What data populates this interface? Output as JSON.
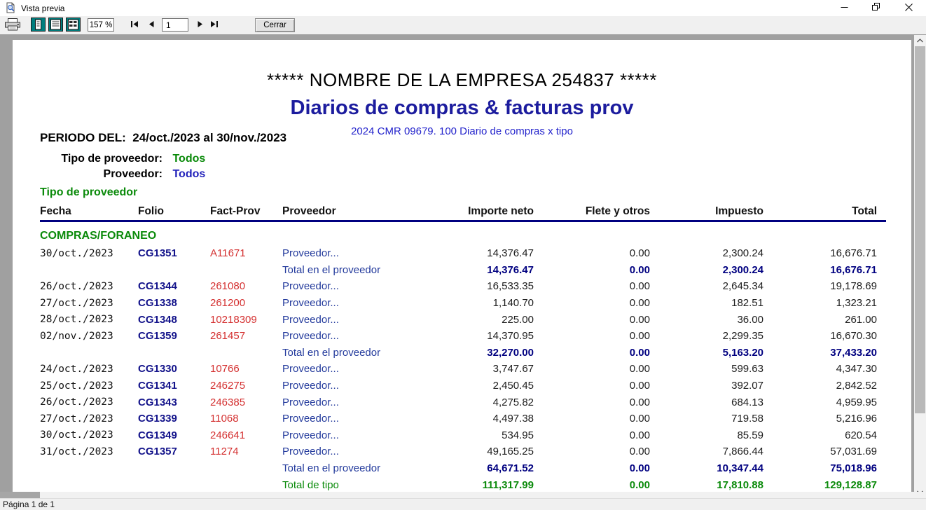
{
  "window": {
    "title": "Vista previa",
    "status": "Página 1 de 1"
  },
  "toolbar": {
    "zoom_value": "157 %",
    "page_value": "1",
    "close_label": "Cerrar"
  },
  "colors": {
    "navy": "#000080",
    "green": "#0a8a0a",
    "red": "#d43030",
    "blue": "#2424cc",
    "title_navy": "#1c1c9e",
    "view_icon_teal": "#007f7f"
  },
  "report": {
    "company_title": "***** NOMBRE DE LA EMPRESA 254837 *****",
    "title": "Diarios de compras & facturas prov",
    "subtitle": "2024 CMR 09679. 100 Diario de compras x tipo",
    "period_label": "PERIODO DEL:",
    "period_value": "24/oct./2023 al 30/nov./2023",
    "filter_type_label": "Tipo de proveedor:",
    "filter_type_value": "Todos",
    "filter_prov_label": "Proveedor:",
    "filter_prov_value": "Todos",
    "group_header": "Tipo de proveedor",
    "section": "COMPRAS/FORANEO",
    "columns": {
      "fecha": "Fecha",
      "folio": "Folio",
      "fact": "Fact-Prov",
      "prov": "Proveedor",
      "neto": "Importe neto",
      "flete": "Flete y otros",
      "imp": "Impuesto",
      "total": "Total"
    },
    "rows": [
      {
        "kind": "d",
        "fecha": "30/oct./2023",
        "folio": "CG1351",
        "fact": "A11671",
        "prov": "Proveedor...",
        "neto": "14,376.47",
        "flete": "0.00",
        "imp": "2,300.24",
        "total": "16,676.71"
      },
      {
        "kind": "s",
        "fecha": "",
        "folio": "",
        "fact": "",
        "prov": "Total en el proveedor",
        "neto": "14,376.47",
        "flete": "0.00",
        "imp": "2,300.24",
        "total": "16,676.71"
      },
      {
        "kind": "d",
        "fecha": "26/oct./2023",
        "folio": "CG1344",
        "fact": "261080",
        "prov": "Proveedor...",
        "neto": "16,533.35",
        "flete": "0.00",
        "imp": "2,645.34",
        "total": "19,178.69"
      },
      {
        "kind": "d",
        "fecha": "27/oct./2023",
        "folio": "CG1338",
        "fact": "261200",
        "prov": "Proveedor...",
        "neto": "1,140.70",
        "flete": "0.00",
        "imp": "182.51",
        "total": "1,323.21"
      },
      {
        "kind": "d",
        "fecha": "28/oct./2023",
        "folio": "CG1348",
        "fact": "10218309",
        "prov": "Proveedor...",
        "neto": "225.00",
        "flete": "0.00",
        "imp": "36.00",
        "total": "261.00"
      },
      {
        "kind": "d",
        "fecha": "02/nov./2023",
        "folio": "CG1359",
        "fact": "261457",
        "prov": "Proveedor...",
        "neto": "14,370.95",
        "flete": "0.00",
        "imp": "2,299.35",
        "total": "16,670.30"
      },
      {
        "kind": "s",
        "fecha": "",
        "folio": "",
        "fact": "",
        "prov": "Total en el proveedor",
        "neto": "32,270.00",
        "flete": "0.00",
        "imp": "5,163.20",
        "total": "37,433.20"
      },
      {
        "kind": "d",
        "fecha": "24/oct./2023",
        "folio": "CG1330",
        "fact": "10766",
        "prov": "Proveedor...",
        "neto": "3,747.67",
        "flete": "0.00",
        "imp": "599.63",
        "total": "4,347.30"
      },
      {
        "kind": "d",
        "fecha": "25/oct./2023",
        "folio": "CG1341",
        "fact": "246275",
        "prov": "Proveedor...",
        "neto": "2,450.45",
        "flete": "0.00",
        "imp": "392.07",
        "total": "2,842.52"
      },
      {
        "kind": "d",
        "fecha": "26/oct./2023",
        "folio": "CG1343",
        "fact": "246385",
        "prov": "Proveedor...",
        "neto": "4,275.82",
        "flete": "0.00",
        "imp": "684.13",
        "total": "4,959.95"
      },
      {
        "kind": "d",
        "fecha": "27/oct./2023",
        "folio": "CG1339",
        "fact": "11068",
        "prov": "Proveedor...",
        "neto": "4,497.38",
        "flete": "0.00",
        "imp": "719.58",
        "total": "5,216.96"
      },
      {
        "kind": "d",
        "fecha": "30/oct./2023",
        "folio": "CG1349",
        "fact": "246641",
        "prov": "Proveedor...",
        "neto": "534.95",
        "flete": "0.00",
        "imp": "85.59",
        "total": "620.54"
      },
      {
        "kind": "d",
        "fecha": "31/oct./2023",
        "folio": "CG1357",
        "fact": "11274",
        "prov": "Proveedor...",
        "neto": "49,165.25",
        "flete": "0.00",
        "imp": "7,866.44",
        "total": "57,031.69"
      },
      {
        "kind": "s",
        "fecha": "",
        "folio": "",
        "fact": "",
        "prov": "Total en el proveedor",
        "neto": "64,671.52",
        "flete": "0.00",
        "imp": "10,347.44",
        "total": "75,018.96"
      },
      {
        "kind": "g",
        "fecha": "",
        "folio": "",
        "fact": "",
        "prov": "Total de tipo",
        "neto": "111,317.99",
        "flete": "0.00",
        "imp": "17,810.88",
        "total": "129,128.87"
      }
    ]
  }
}
